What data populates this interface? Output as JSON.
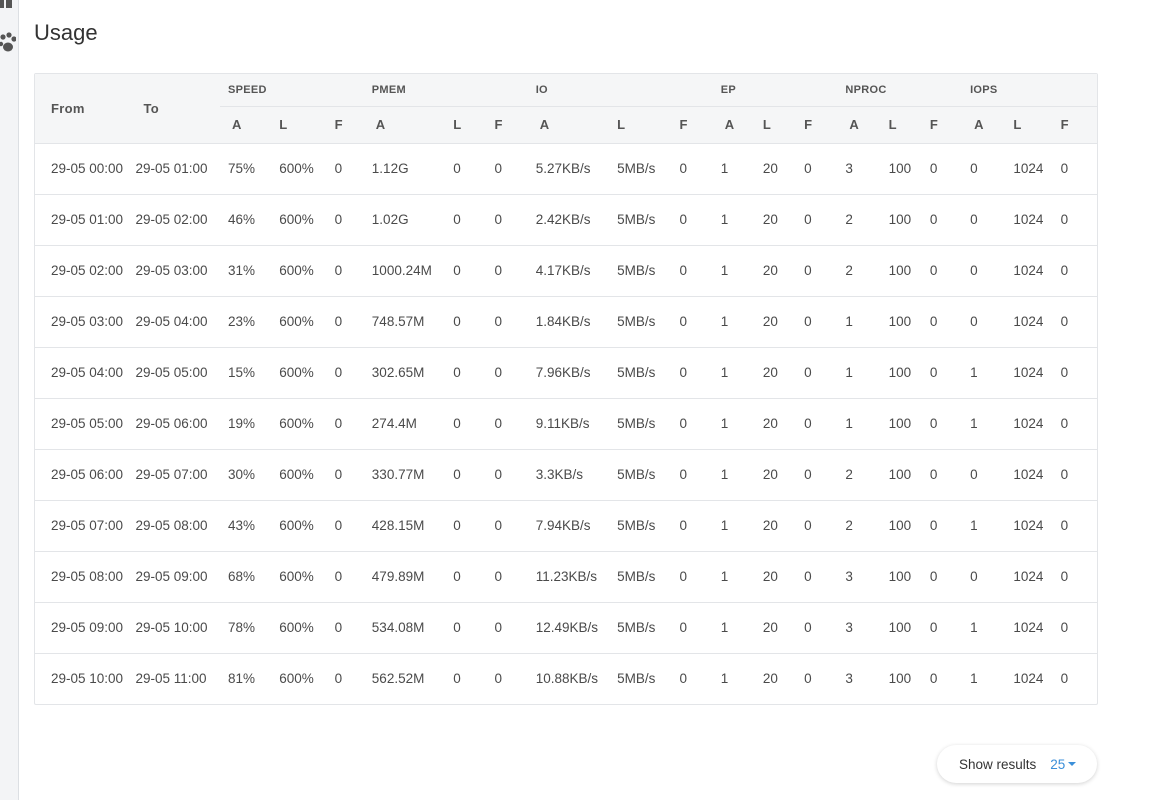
{
  "page": {
    "title": "Usage"
  },
  "table": {
    "fixed_headers": [
      "From",
      "To"
    ],
    "groups": [
      "SPEED",
      "PMEM",
      "IO",
      "EP",
      "NPROC",
      "IOPS"
    ],
    "sub_headers": [
      "A",
      "L",
      "F"
    ],
    "rows": [
      [
        "29-05 00:00",
        "29-05 01:00",
        "75%",
        "600%",
        "0",
        "1.12G",
        "0",
        "0",
        "5.27KB/s",
        "5MB/s",
        "0",
        "1",
        "20",
        "0",
        "3",
        "100",
        "0",
        "0",
        "1024",
        "0"
      ],
      [
        "29-05 01:00",
        "29-05 02:00",
        "46%",
        "600%",
        "0",
        "1.02G",
        "0",
        "0",
        "2.42KB/s",
        "5MB/s",
        "0",
        "1",
        "20",
        "0",
        "2",
        "100",
        "0",
        "0",
        "1024",
        "0"
      ],
      [
        "29-05 02:00",
        "29-05 03:00",
        "31%",
        "600%",
        "0",
        "1000.24M",
        "0",
        "0",
        "4.17KB/s",
        "5MB/s",
        "0",
        "1",
        "20",
        "0",
        "2",
        "100",
        "0",
        "0",
        "1024",
        "0"
      ],
      [
        "29-05 03:00",
        "29-05 04:00",
        "23%",
        "600%",
        "0",
        "748.57M",
        "0",
        "0",
        "1.84KB/s",
        "5MB/s",
        "0",
        "1",
        "20",
        "0",
        "1",
        "100",
        "0",
        "0",
        "1024",
        "0"
      ],
      [
        "29-05 04:00",
        "29-05 05:00",
        "15%",
        "600%",
        "0",
        "302.65M",
        "0",
        "0",
        "7.96KB/s",
        "5MB/s",
        "0",
        "1",
        "20",
        "0",
        "1",
        "100",
        "0",
        "1",
        "1024",
        "0"
      ],
      [
        "29-05 05:00",
        "29-05 06:00",
        "19%",
        "600%",
        "0",
        "274.4M",
        "0",
        "0",
        "9.11KB/s",
        "5MB/s",
        "0",
        "1",
        "20",
        "0",
        "1",
        "100",
        "0",
        "1",
        "1024",
        "0"
      ],
      [
        "29-05 06:00",
        "29-05 07:00",
        "30%",
        "600%",
        "0",
        "330.77M",
        "0",
        "0",
        "3.3KB/s",
        "5MB/s",
        "0",
        "1",
        "20",
        "0",
        "2",
        "100",
        "0",
        "0",
        "1024",
        "0"
      ],
      [
        "29-05 07:00",
        "29-05 08:00",
        "43%",
        "600%",
        "0",
        "428.15M",
        "0",
        "0",
        "7.94KB/s",
        "5MB/s",
        "0",
        "1",
        "20",
        "0",
        "2",
        "100",
        "0",
        "1",
        "1024",
        "0"
      ],
      [
        "29-05 08:00",
        "29-05 09:00",
        "68%",
        "600%",
        "0",
        "479.89M",
        "0",
        "0",
        "11.23KB/s",
        "5MB/s",
        "0",
        "1",
        "20",
        "0",
        "3",
        "100",
        "0",
        "0",
        "1024",
        "0"
      ],
      [
        "29-05 09:00",
        "29-05 10:00",
        "78%",
        "600%",
        "0",
        "534.08M",
        "0",
        "0",
        "12.49KB/s",
        "5MB/s",
        "0",
        "1",
        "20",
        "0",
        "3",
        "100",
        "0",
        "1",
        "1024",
        "0"
      ],
      [
        "29-05 10:00",
        "29-05 11:00",
        "81%",
        "600%",
        "0",
        "562.52M",
        "0",
        "0",
        "10.88KB/s",
        "5MB/s",
        "0",
        "1",
        "20",
        "0",
        "3",
        "100",
        "0",
        "1",
        "1024",
        "0"
      ]
    ]
  },
  "pagination": {
    "label": "Show results",
    "value": "25"
  },
  "sidebar": {
    "icons": [
      "grid-icon",
      "paw-icon"
    ]
  }
}
